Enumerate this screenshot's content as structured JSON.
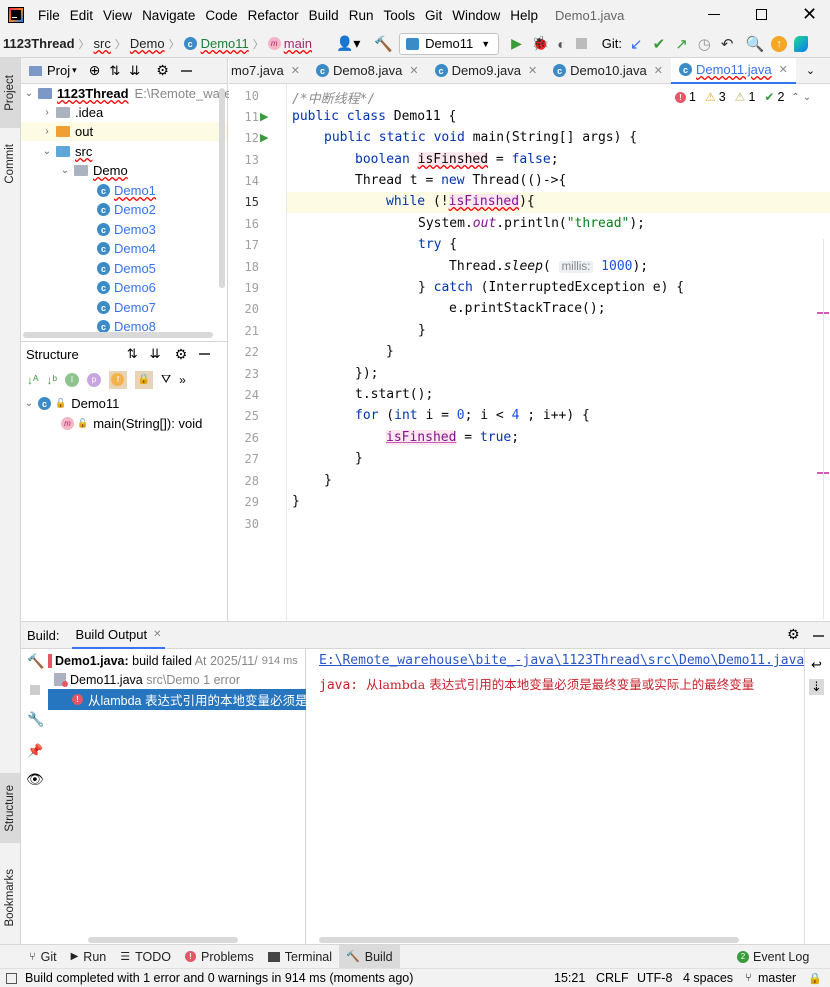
{
  "menubar": {
    "items": [
      "File",
      "Edit",
      "View",
      "Navigate",
      "Code",
      "Refactor",
      "Build",
      "Run",
      "Tools",
      "Git",
      "Window",
      "Help"
    ],
    "title": "Demo1.java"
  },
  "navbar": {
    "breadcrumbs": [
      "1123Thread",
      "src",
      "Demo",
      "Demo11",
      "main"
    ],
    "run_config": "Demo11",
    "git_label": "Git:"
  },
  "leftstripe": {
    "project": "Project",
    "commit": "Commit",
    "structure": "Structure",
    "bookmarks": "Bookmarks"
  },
  "project": {
    "header": "Proj",
    "root_name": "1123Thread",
    "root_path": "E:\\Remote_ware",
    "items": [
      ".idea",
      "out",
      "src",
      "Demo",
      "Demo1",
      "Demo2",
      "Demo3",
      "Demo4",
      "Demo5",
      "Demo6",
      "Demo7",
      "Demo8"
    ]
  },
  "structure": {
    "header": "Structure",
    "class_name": "Demo11",
    "method": "main(String[]): void"
  },
  "tabs": [
    "mo7.java",
    "Demo8.java",
    "Demo9.java",
    "Demo10.java",
    "Demo11.java"
  ],
  "inspections": {
    "errors": "1",
    "warnings": "3",
    "weak": "1",
    "ok": "2"
  },
  "editor": {
    "line_numbers": [
      "10",
      "11",
      "12",
      "13",
      "14",
      "15",
      "16",
      "17",
      "18",
      "19",
      "20",
      "21",
      "22",
      "23",
      "24",
      "25",
      "26",
      "27",
      "28",
      "29",
      "30"
    ],
    "comment": "/*中断线程*/",
    "l11": [
      "public class",
      " Demo11 {"
    ],
    "l12": [
      "public static void",
      " main(String[] args) {"
    ],
    "l13": [
      "boolean ",
      "isFinshed",
      " = ",
      "false",
      ";"
    ],
    "l14": [
      "Thread t = ",
      "new",
      " Thread(()->{"
    ],
    "l15": [
      "while",
      " (!",
      "isFinshed",
      "){"
    ],
    "l16": [
      "System.",
      "out",
      ".println(",
      "\"thread\"",
      ");"
    ],
    "l17": [
      "try",
      " {"
    ],
    "l18": [
      "Thread.",
      "sleep",
      "( ",
      "millis:",
      " ",
      "1000",
      ");"
    ],
    "l19": [
      "} ",
      "catch",
      " (InterruptedException e) {"
    ],
    "l20": "e.printStackTrace();",
    "l21": "}",
    "l22": "}",
    "l23": "});",
    "l24": "t.start();",
    "l25": [
      "for",
      " (",
      "int",
      " i = ",
      "0",
      "; i < ",
      "4",
      " ; i++) {"
    ],
    "l26": [
      "isFinshed",
      " = ",
      "true",
      ";"
    ],
    "l27": "}",
    "l28": "}",
    "l29": "}"
  },
  "build": {
    "label": "Build:",
    "tab": "Build Output",
    "entry1_name": "Demo1.java:",
    "entry1_status": " build failed",
    "entry1_time": " At 2025/11/",
    "entry1_ms": "914 ms",
    "entry2_name": "Demo11.java",
    "entry2_path": " src\\Demo 1 error",
    "entry3": "从lambda 表达式引用的本地变量必须是最",
    "out_path": "E:\\Remote_warehouse\\bite_-java\\1123Thread\\src\\Demo\\Demo11.java",
    "out_prefix": "java: ",
    "out_msg": "从lambda 表达式引用的本地变量必须是最终变量或实际上的最终变量"
  },
  "toolwindows": [
    "Git",
    "Run",
    "TODO",
    "Problems",
    "Terminal",
    "Build"
  ],
  "event_log": "Event Log",
  "status": {
    "message": "Build completed with 1 error and 0 warnings in 914 ms (moments ago)",
    "position": "15:21",
    "line_sep": "CRLF",
    "encoding": "UTF-8",
    "indent": "4 spaces",
    "branch": "master"
  }
}
